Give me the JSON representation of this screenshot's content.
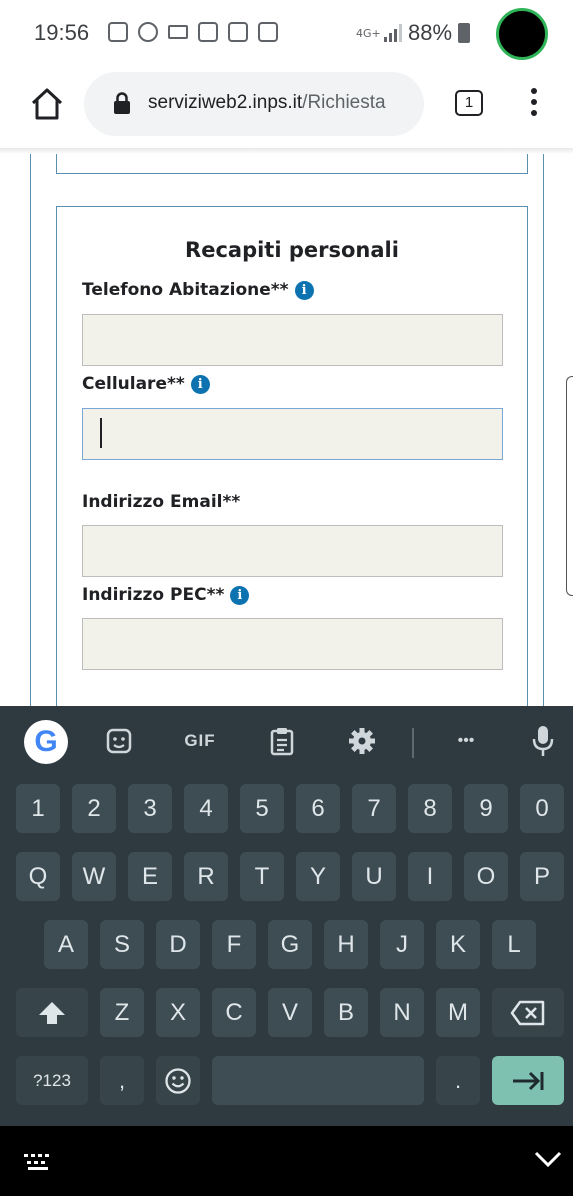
{
  "status_bar": {
    "time": "19:56",
    "notification_icons": [
      "screenshot-icon",
      "whatsapp-icon",
      "keyboard-notification-icon",
      "sim-icon",
      "screenshot-icon",
      "wifi-hotspot-icon"
    ],
    "network": "4G+",
    "battery": "88%"
  },
  "browser": {
    "url_host": "serviziweb2.inps.it",
    "url_path": "/Richiesta",
    "tab_count": "1"
  },
  "form": {
    "section_title": "Recapiti personali",
    "fields": [
      {
        "label": "Telefono Abitazione**",
        "value": "",
        "has_info": true
      },
      {
        "label": "Cellulare**",
        "value": "",
        "has_info": true
      },
      {
        "label": "Indirizzo Email**",
        "value": "",
        "has_info": false
      },
      {
        "label": "Indirizzo PEC**",
        "value": "",
        "has_info": true
      }
    ]
  },
  "keyboard": {
    "toolbar": {
      "google": "G",
      "gif": "GIF",
      "more": "•••"
    },
    "row_numbers": [
      "1",
      "2",
      "3",
      "4",
      "5",
      "6",
      "7",
      "8",
      "9",
      "0"
    ],
    "row_1": [
      "Q",
      "W",
      "E",
      "R",
      "T",
      "Y",
      "U",
      "I",
      "O",
      "P"
    ],
    "row_2": [
      "A",
      "S",
      "D",
      "F",
      "G",
      "H",
      "J",
      "K",
      "L"
    ],
    "row_3": [
      "Z",
      "X",
      "C",
      "V",
      "B",
      "N",
      "M"
    ],
    "bottom": {
      "symbols": "?123",
      "comma": ",",
      "period": "."
    }
  },
  "colors": {
    "accent_blue": "#0c72b0",
    "border_blue": "#5a8fb0",
    "input_bg": "#f3f2ea",
    "keyboard_bg": "#2e3a40",
    "key_bg": "#3e4c53",
    "enter_key": "#7fc1b1"
  }
}
